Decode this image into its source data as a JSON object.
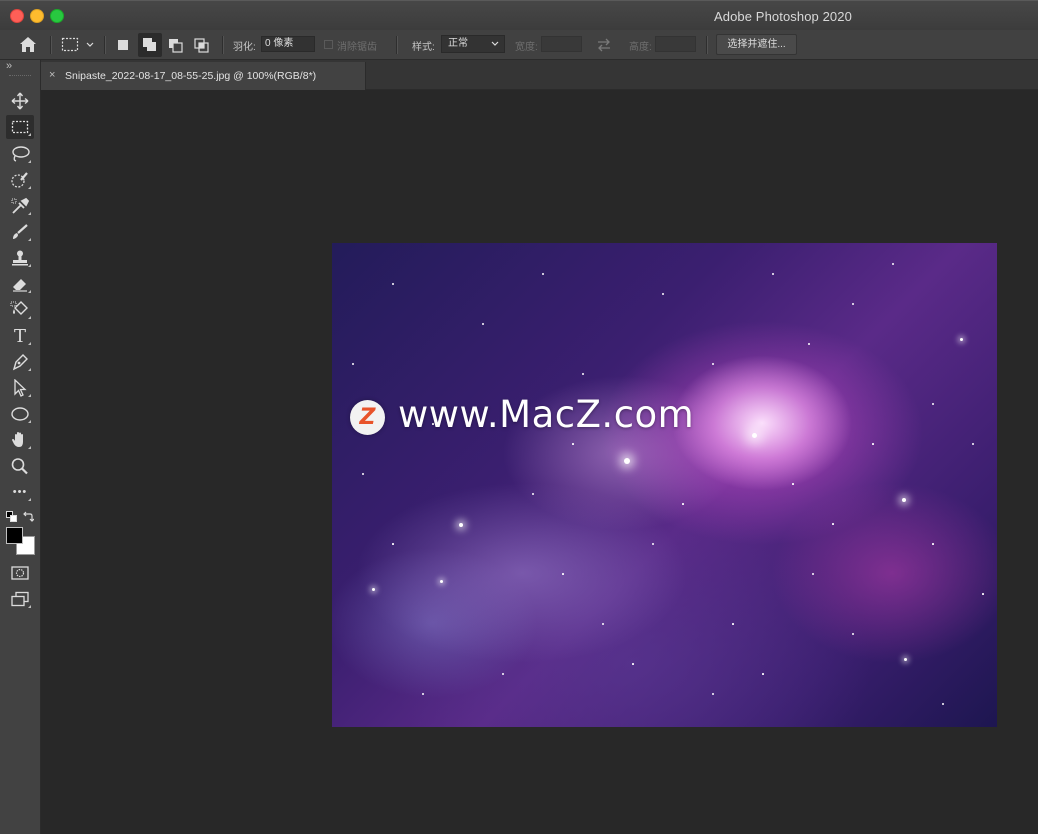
{
  "window": {
    "title": "Adobe Photoshop 2020"
  },
  "options_bar": {
    "feather_label": "羽化:",
    "feather_value": "0 像素",
    "antialias_label": "消除锯齿",
    "style_label": "样式:",
    "style_value": "正常",
    "width_label": "宽度:",
    "height_label": "高度:",
    "select_mask_button": "选择并遮住..."
  },
  "document": {
    "tab_close": "×",
    "tab_title": "Snipaste_2022-08-17_08-55-25.jpg @ 100%(RGB/8*)"
  },
  "image": {
    "watermark_text": "www.MacZ.com",
    "logo_letter": "Z"
  },
  "toolbar": {
    "collapse_glyph": "»",
    "tools": [
      "move-tool",
      "rectangular-marquee-tool",
      "lasso-tool",
      "quick-selection-tool",
      "eyedropper-tool",
      "brush-tool",
      "clone-stamp-tool",
      "eraser-tool",
      "paint-bucket-tool",
      "type-tool",
      "pen-tool",
      "path-selection-tool",
      "ellipse-tool",
      "hand-tool",
      "zoom-tool",
      "more-tools"
    ],
    "type_glyph": "T",
    "more_glyph": "•••"
  },
  "colors": {
    "foreground": "#000000",
    "background": "#ffffff",
    "watermark_logo_accent": "#e8532a"
  }
}
